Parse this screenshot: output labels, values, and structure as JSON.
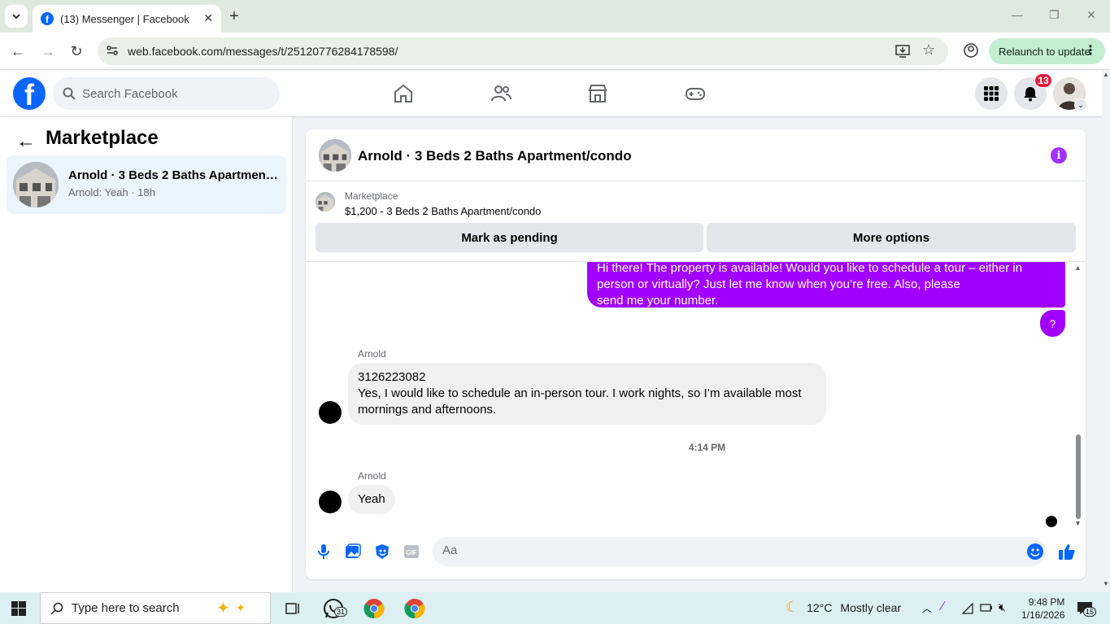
{
  "browser": {
    "tab_title": "(13) Messenger | Facebook",
    "url": "web.facebook.com/messages/t/25120776284178598/",
    "relaunch_label": "Relaunch to update"
  },
  "facebook": {
    "search_placeholder": "Search Facebook",
    "notification_count": "13",
    "brand_color": "#0866ff"
  },
  "sidebar": {
    "title": "Marketplace",
    "conversation": {
      "title": "Arnold · 3 Beds 2 Baths Apartment...",
      "preview": "Arnold: Yeah · 18h"
    }
  },
  "chat": {
    "header_title": "Arnold · 3 Beds 2 Baths Apartment/condo",
    "listing_label": "Marketplace",
    "listing_desc": "$1,200 - 3 Beds 2 Baths Apartment/condo",
    "mark_pending_label": "Mark as pending",
    "more_options_label": "More options",
    "outgoing_line1": "Hi there! The property is available! Would you like to schedule a tour – either in",
    "outgoing_line2": "person or virtually? Just let me know when you’re free. Also, please",
    "outgoing_line3": "send me your number.",
    "outgoing_question": "?",
    "msg1_sender": "Arnold",
    "msg1_line1": "3126223082",
    "msg1_line2": "Yes, I would like to schedule an in-person tour. I work nights, so I’m available most",
    "msg1_line3": "mornings and afternoons.",
    "timestamp": "4:14 PM",
    "msg2_sender": "Arnold",
    "msg2_text": "Yeah",
    "composer_placeholder": "Aa",
    "accent_color": "#a100ff"
  },
  "taskbar": {
    "search_placeholder": "Type here to search",
    "whatsapp_badge": "31",
    "temperature": "12°C",
    "weather_desc": "Mostly clear",
    "time": "9:48 PM",
    "date": "1/16/2026",
    "notification_count": "15"
  }
}
